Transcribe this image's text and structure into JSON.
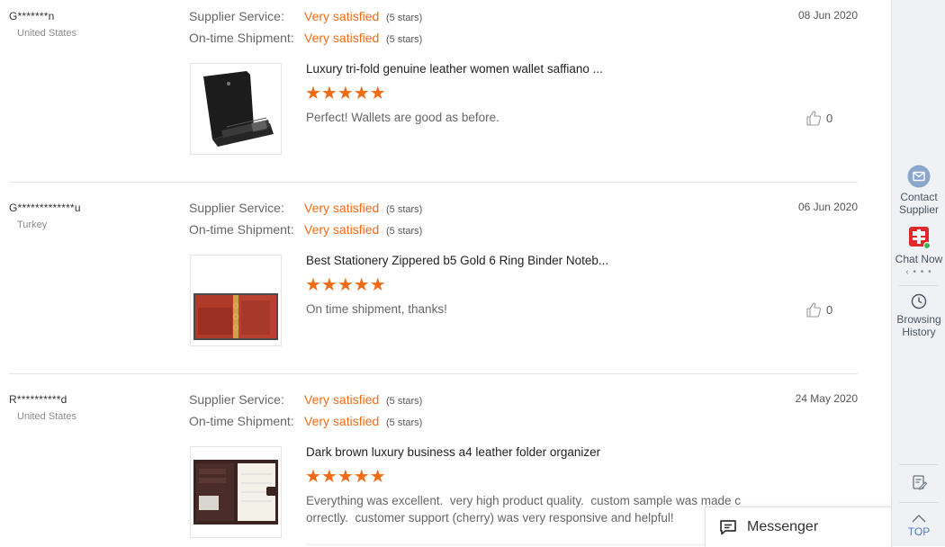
{
  "labels": {
    "supplier_service": "Supplier Service:",
    "ontime_shipment": "On-time Shipment:"
  },
  "reviews": [
    {
      "user": "G*******n",
      "country": "United States",
      "supplier_service": "Very satisfied",
      "supplier_service_stars": "(5 stars)",
      "ontime_shipment": "Very satisfied",
      "ontime_shipment_stars": "(5 stars)",
      "date": "08 Jun 2020",
      "product_title": "Luxury tri-fold genuine leather women wallet saffiano ...",
      "stars": "★★★★★",
      "rating": 5,
      "comment": "Perfect! Wallets are good as before.",
      "likes": "0"
    },
    {
      "user": "G*************u",
      "country": "Turkey",
      "supplier_service": "Very satisfied",
      "supplier_service_stars": "(5 stars)",
      "ontime_shipment": "Very satisfied",
      "ontime_shipment_stars": "(5 stars)",
      "date": "06 Jun 2020",
      "product_title": "Best Stationery Zippered b5 Gold 6 Ring Binder Noteb...",
      "stars": "★★★★★",
      "rating": 5,
      "comment": "On time shipment, thanks!",
      "likes": "0"
    },
    {
      "user": "R**********d",
      "country": "United States",
      "supplier_service": "Very satisfied",
      "supplier_service_stars": "(5 stars)",
      "ontime_shipment": "Very satisfied",
      "ontime_shipment_stars": "(5 stars)",
      "date": "24 May 2020",
      "product_title": "Dark brown luxury business a4 leather folder organizer",
      "stars": "★★★★★",
      "rating": 5,
      "comment": "Everything was excellent.  very high product quality.  custom sample was made c\norrectly.  customer support (cherry) was very responsive and helpful!",
      "likes": ""
    }
  ],
  "sidebar": {
    "contact_line1": "Contact",
    "contact_line2": "Supplier",
    "chat": "Chat Now",
    "dots": "‹ • • •",
    "history_line1": "Browsing",
    "history_line2": "History",
    "top": "TOP"
  },
  "messenger": {
    "label": "Messenger"
  },
  "colors": {
    "accent": "#f06b16",
    "sidebar_bg": "#eff1f4",
    "chat_red": "#e02a2a",
    "online_green": "#3cb34a"
  }
}
